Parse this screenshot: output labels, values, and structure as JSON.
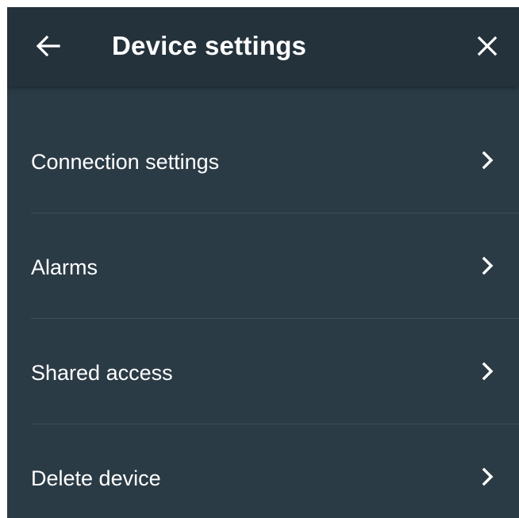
{
  "header": {
    "title": "Device settings",
    "back_icon": "arrow-left-icon",
    "close_icon": "close-icon"
  },
  "menu": {
    "items": [
      {
        "label": "Connection settings",
        "icon": "chevron-right-icon"
      },
      {
        "label": "Alarms",
        "icon": "chevron-right-icon"
      },
      {
        "label": "Shared access",
        "icon": "chevron-right-icon"
      },
      {
        "label": "Delete device",
        "icon": "chevron-right-icon"
      }
    ]
  },
  "colors": {
    "appbar": "#24323c",
    "background": "#2b3b46",
    "divider": "#3c4d59",
    "text": "#ffffff"
  }
}
